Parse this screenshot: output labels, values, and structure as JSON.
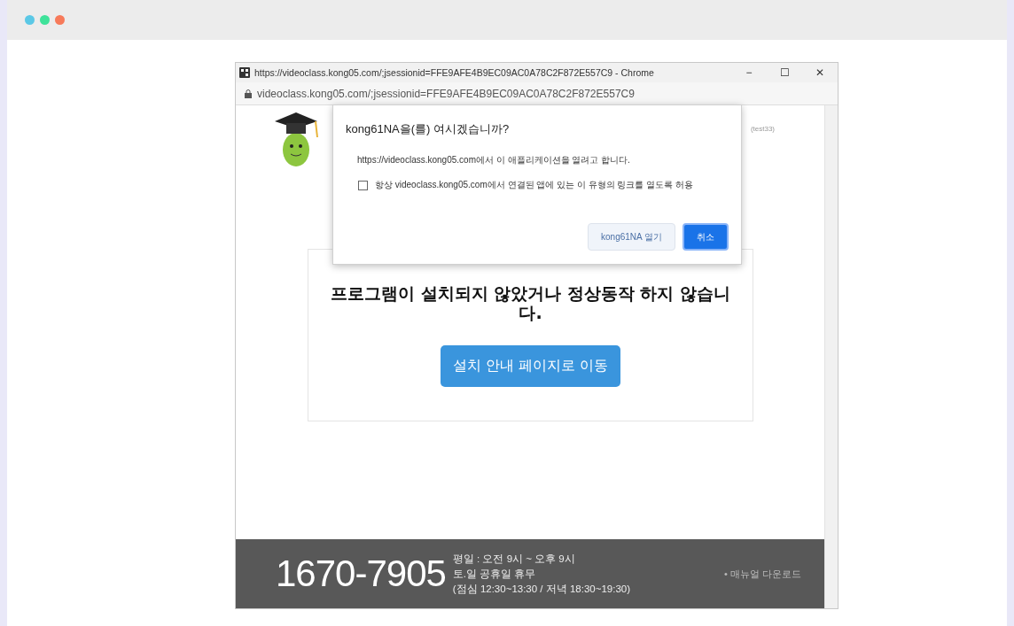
{
  "window": {
    "title": "https://videoclass.kong05.com/;jsessionid=FFE9AFE4B9EC09AC0A78C2F872E557C9 - Chrome",
    "address": "videoclass.kong05.com/;jsessionid=FFE9AFE4B9EC09AC0A78C2F872E557C9",
    "controls": [
      "−",
      "☐",
      "✕"
    ]
  },
  "page": {
    "header_user": "(test33)",
    "notice": "프로그램이 설치되지 않았거나 정상동작 하지 않습니다.",
    "install_button": "설치 안내 페이지로 이동"
  },
  "dialog": {
    "title": "kong61NA을(를) 여시겠습니까?",
    "message": "https://videoclass.kong05.com에서 이 애플리케이션을 열려고 합니다.",
    "checkbox": {
      "label": "항상 videoclass.kong05.com에서 연결된 앱에 있는 이 유형의 링크를 열도록 허용",
      "checked": false
    },
    "buttons": [
      {
        "label": "kong61NA 열기",
        "primary": false
      },
      {
        "label": "취소",
        "primary": true
      }
    ]
  },
  "footer": {
    "phone": "1670-7905",
    "hours": [
      "평일 : 오전 9시 ~ 오후 9시",
      "토.일 공휴일 휴무",
      "(점심 12:30~13:30 / 저녁 18:30~19:30)"
    ],
    "link": "• 매뉴얼 다운로드"
  }
}
